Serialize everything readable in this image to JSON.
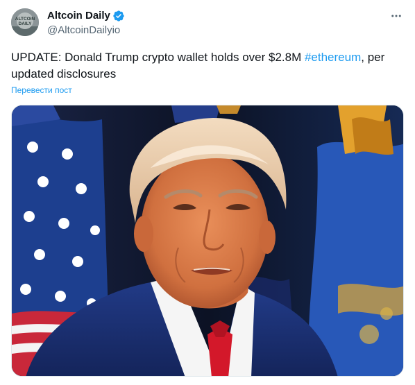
{
  "tweet": {
    "author": {
      "display_name": "Altcoin Daily",
      "handle": "@AltcoinDailyio",
      "avatar_text": "ALTCOIN DAILY",
      "verified": true
    },
    "text_before": "UPDATE: Donald Trump crypto wallet holds over $2.8M ",
    "hashtag": "#ethereum",
    "text_after": ", per updated disclosures",
    "translate_label": "Перевести пост",
    "more_icon": "more-horizontal-icon"
  },
  "colors": {
    "text": "#0f1419",
    "secondary": "#536471",
    "link": "#1d9bf0",
    "verified": "#1d9bf0"
  }
}
